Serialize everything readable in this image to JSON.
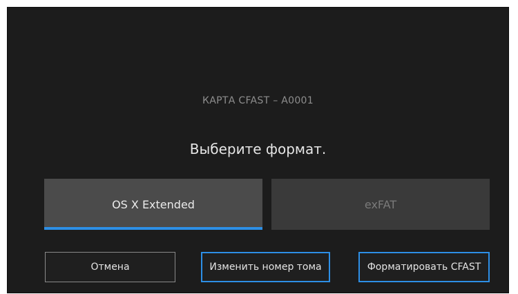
{
  "dialog": {
    "card_title": "КАРТА CFAST – A0001",
    "prompt": "Выберите формат."
  },
  "formats": {
    "option_1": {
      "label": "OS X Extended",
      "selected": true
    },
    "option_2": {
      "label": "exFAT",
      "selected": false
    }
  },
  "buttons": {
    "cancel": "Отмена",
    "rename_volume": "Изменить номер тома",
    "format": "Форматировать CFAST"
  },
  "colors": {
    "accent": "#2d8fe6",
    "background": "#1c1c1c"
  }
}
